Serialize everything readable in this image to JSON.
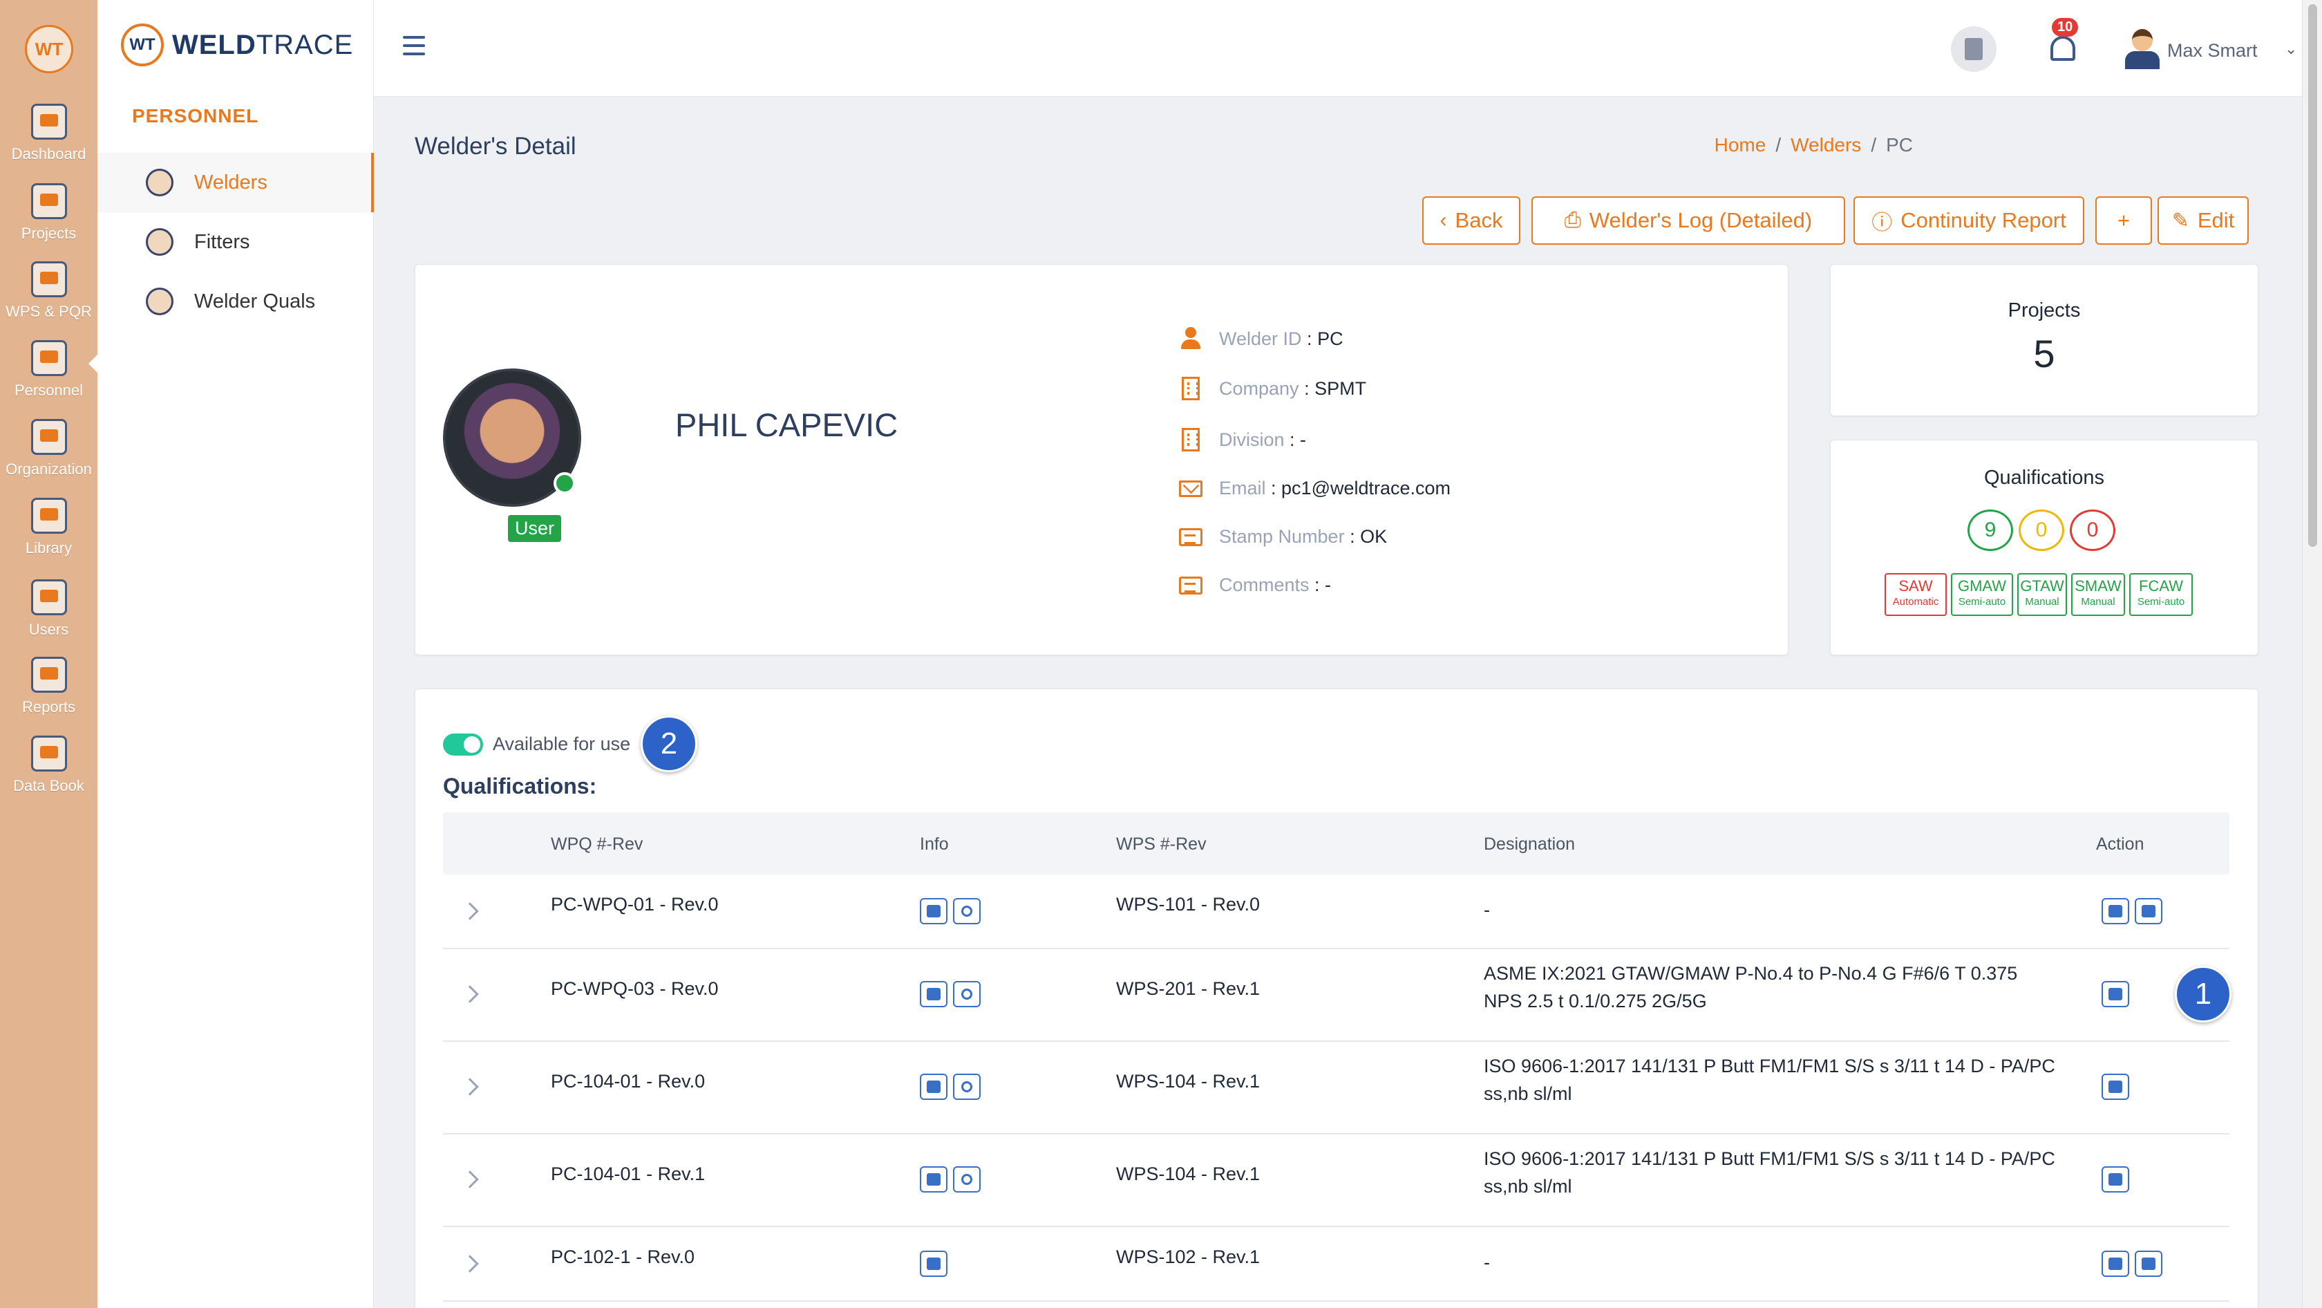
{
  "app": {
    "brand_wt": "WT",
    "brand_name_bold": "WELD",
    "brand_name_light": "TRACE"
  },
  "rail": [
    {
      "label": "Dashboard",
      "icon": "dashboard-icon"
    },
    {
      "label": "Projects",
      "icon": "projects-icon"
    },
    {
      "label": "WPS & PQR",
      "icon": "wps-pqr-icon"
    },
    {
      "label": "Personnel",
      "icon": "personnel-icon",
      "active": true
    },
    {
      "label": "Organization",
      "icon": "organization-icon"
    },
    {
      "label": "Library",
      "icon": "library-icon"
    },
    {
      "label": "Users",
      "icon": "users-icon"
    },
    {
      "label": "Reports",
      "icon": "reports-icon"
    },
    {
      "label": "Data Book",
      "icon": "data-book-icon"
    }
  ],
  "subnav": {
    "heading": "PERSONNEL",
    "items": [
      {
        "label": "Welders",
        "icon": "welder-icon",
        "active": true
      },
      {
        "label": "Fitters",
        "icon": "fitter-icon"
      },
      {
        "label": "Welder Quals",
        "icon": "welder-quals-icon"
      }
    ]
  },
  "topbar": {
    "notification_count": "10",
    "user_name": "Max Smart"
  },
  "page": {
    "title": "Welder's Detail",
    "breadcrumb": [
      "Home",
      "Welders",
      "PC"
    ]
  },
  "actions": {
    "back": "Back",
    "log": "Welder's Log (Detailed)",
    "continuity": "Continuity Report",
    "add": "+",
    "edit": "Edit"
  },
  "profile": {
    "name": "PHIL CAPEVIC",
    "role_badge": "User",
    "fields": [
      {
        "label": "Welder ID",
        "value": "PC",
        "icon": "person-icon"
      },
      {
        "label": "Company",
        "value": "SPMT",
        "icon": "building-icon"
      },
      {
        "label": "Division",
        "value": "-",
        "icon": "building-icon"
      },
      {
        "label": "Email",
        "value": "pc1@weldtrace.com",
        "icon": "mail-icon"
      },
      {
        "label": "Stamp Number",
        "value": "OK",
        "icon": "chat-icon"
      },
      {
        "label": "Comments",
        "value": "-",
        "icon": "chat-icon"
      }
    ]
  },
  "stats": {
    "projects_title": "Projects",
    "projects_count": "5",
    "quals_title": "Qualifications",
    "qual_counts": [
      {
        "value": "9",
        "color": "#22a447"
      },
      {
        "value": "0",
        "color": "#f2b705"
      },
      {
        "value": "0",
        "color": "#e53935"
      }
    ],
    "processes": [
      {
        "name": "SAW",
        "type": "Automatic",
        "color": "#e53935"
      },
      {
        "name": "GMAW",
        "type": "Semi-auto",
        "color": "#22a447"
      },
      {
        "name": "GTAW",
        "type": "Manual",
        "color": "#22a447"
      },
      {
        "name": "SMAW",
        "type": "Manual",
        "color": "#22a447"
      },
      {
        "name": "FCAW",
        "type": "Semi-auto",
        "color": "#22a447"
      }
    ]
  },
  "quals_section": {
    "toggle_label": "Available for use",
    "toggle_on": true,
    "heading": "Qualifications:",
    "callout_1": "1",
    "callout_2": "2",
    "columns": [
      "WPQ #-Rev",
      "Info",
      "WPS #-Rev",
      "Designation",
      "Action"
    ],
    "rows": [
      {
        "wpq": "PC-WPQ-01 - Rev.0",
        "wps": "WPS-101 - Rev.0",
        "designation": [
          "-"
        ],
        "info": [
          "check",
          "attach"
        ],
        "actions": [
          "edit",
          "delete"
        ]
      },
      {
        "wpq": "PC-WPQ-03 - Rev.0",
        "wps": "WPS-201 - Rev.1",
        "designation": [
          "ASME IX:2021 GTAW/GMAW P-No.4 to P-No.4 G F#6/6 T 0.375",
          "NPS 2.5 t 0.1/0.275 2G/5G"
        ],
        "info": [
          "check",
          "cert"
        ],
        "actions": [
          "edit"
        ]
      },
      {
        "wpq": "PC-104-01 - Rev.0",
        "wps": "WPS-104 - Rev.1",
        "designation": [
          "ISO 9606-1:2017 141/131 P Butt FM1/FM1 S/S s 3/11 t 14 D - PA/PC",
          "ss,nb sl/ml"
        ],
        "info": [
          "check",
          "cert"
        ],
        "actions": [
          "edit"
        ]
      },
      {
        "wpq": "PC-104-01 - Rev.1",
        "wps": "WPS-104 - Rev.1",
        "designation": [
          "ISO 9606-1:2017 141/131 P Butt FM1/FM1 S/S s 3/11 t 14 D - PA/PC",
          "ss,nb sl/ml"
        ],
        "info": [
          "check",
          "cert"
        ],
        "actions": [
          "edit"
        ]
      },
      {
        "wpq": "PC-102-1 - Rev.0",
        "wps": "WPS-102 - Rev.1",
        "designation": [
          "-"
        ],
        "info": [
          "check"
        ],
        "actions": [
          "edit",
          "delete"
        ]
      }
    ]
  }
}
